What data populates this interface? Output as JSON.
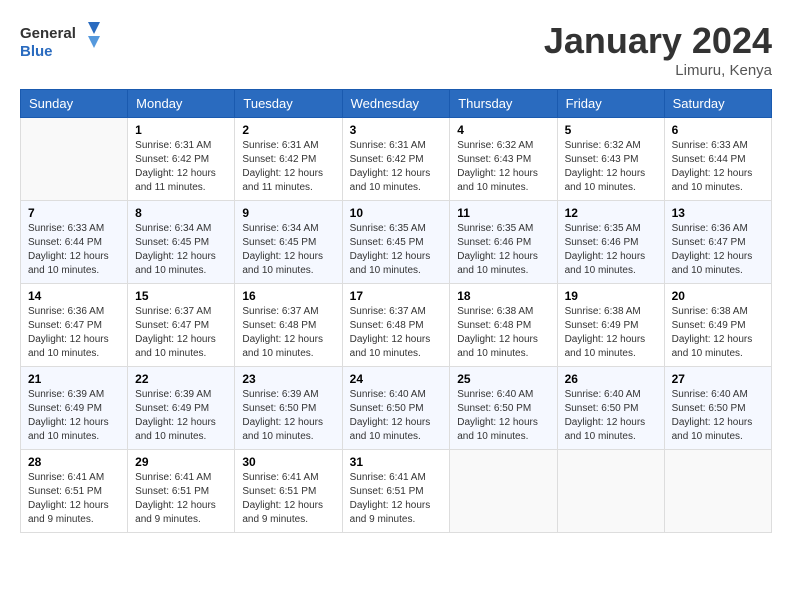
{
  "header": {
    "logo_line1": "General",
    "logo_line2": "Blue",
    "month": "January 2024",
    "location": "Limuru, Kenya"
  },
  "days_of_week": [
    "Sunday",
    "Monday",
    "Tuesday",
    "Wednesday",
    "Thursday",
    "Friday",
    "Saturday"
  ],
  "weeks": [
    [
      {
        "day": "",
        "sunrise": "",
        "sunset": "",
        "daylight": ""
      },
      {
        "day": "1",
        "sunrise": "6:31 AM",
        "sunset": "6:42 PM",
        "daylight": "12 hours and 11 minutes."
      },
      {
        "day": "2",
        "sunrise": "6:31 AM",
        "sunset": "6:42 PM",
        "daylight": "12 hours and 11 minutes."
      },
      {
        "day": "3",
        "sunrise": "6:31 AM",
        "sunset": "6:42 PM",
        "daylight": "12 hours and 10 minutes."
      },
      {
        "day": "4",
        "sunrise": "6:32 AM",
        "sunset": "6:43 PM",
        "daylight": "12 hours and 10 minutes."
      },
      {
        "day": "5",
        "sunrise": "6:32 AM",
        "sunset": "6:43 PM",
        "daylight": "12 hours and 10 minutes."
      },
      {
        "day": "6",
        "sunrise": "6:33 AM",
        "sunset": "6:44 PM",
        "daylight": "12 hours and 10 minutes."
      }
    ],
    [
      {
        "day": "7",
        "sunrise": "6:33 AM",
        "sunset": "6:44 PM",
        "daylight": "12 hours and 10 minutes."
      },
      {
        "day": "8",
        "sunrise": "6:34 AM",
        "sunset": "6:45 PM",
        "daylight": "12 hours and 10 minutes."
      },
      {
        "day": "9",
        "sunrise": "6:34 AM",
        "sunset": "6:45 PM",
        "daylight": "12 hours and 10 minutes."
      },
      {
        "day": "10",
        "sunrise": "6:35 AM",
        "sunset": "6:45 PM",
        "daylight": "12 hours and 10 minutes."
      },
      {
        "day": "11",
        "sunrise": "6:35 AM",
        "sunset": "6:46 PM",
        "daylight": "12 hours and 10 minutes."
      },
      {
        "day": "12",
        "sunrise": "6:35 AM",
        "sunset": "6:46 PM",
        "daylight": "12 hours and 10 minutes."
      },
      {
        "day": "13",
        "sunrise": "6:36 AM",
        "sunset": "6:47 PM",
        "daylight": "12 hours and 10 minutes."
      }
    ],
    [
      {
        "day": "14",
        "sunrise": "6:36 AM",
        "sunset": "6:47 PM",
        "daylight": "12 hours and 10 minutes."
      },
      {
        "day": "15",
        "sunrise": "6:37 AM",
        "sunset": "6:47 PM",
        "daylight": "12 hours and 10 minutes."
      },
      {
        "day": "16",
        "sunrise": "6:37 AM",
        "sunset": "6:48 PM",
        "daylight": "12 hours and 10 minutes."
      },
      {
        "day": "17",
        "sunrise": "6:37 AM",
        "sunset": "6:48 PM",
        "daylight": "12 hours and 10 minutes."
      },
      {
        "day": "18",
        "sunrise": "6:38 AM",
        "sunset": "6:48 PM",
        "daylight": "12 hours and 10 minutes."
      },
      {
        "day": "19",
        "sunrise": "6:38 AM",
        "sunset": "6:49 PM",
        "daylight": "12 hours and 10 minutes."
      },
      {
        "day": "20",
        "sunrise": "6:38 AM",
        "sunset": "6:49 PM",
        "daylight": "12 hours and 10 minutes."
      }
    ],
    [
      {
        "day": "21",
        "sunrise": "6:39 AM",
        "sunset": "6:49 PM",
        "daylight": "12 hours and 10 minutes."
      },
      {
        "day": "22",
        "sunrise": "6:39 AM",
        "sunset": "6:49 PM",
        "daylight": "12 hours and 10 minutes."
      },
      {
        "day": "23",
        "sunrise": "6:39 AM",
        "sunset": "6:50 PM",
        "daylight": "12 hours and 10 minutes."
      },
      {
        "day": "24",
        "sunrise": "6:40 AM",
        "sunset": "6:50 PM",
        "daylight": "12 hours and 10 minutes."
      },
      {
        "day": "25",
        "sunrise": "6:40 AM",
        "sunset": "6:50 PM",
        "daylight": "12 hours and 10 minutes."
      },
      {
        "day": "26",
        "sunrise": "6:40 AM",
        "sunset": "6:50 PM",
        "daylight": "12 hours and 10 minutes."
      },
      {
        "day": "27",
        "sunrise": "6:40 AM",
        "sunset": "6:50 PM",
        "daylight": "12 hours and 10 minutes."
      }
    ],
    [
      {
        "day": "28",
        "sunrise": "6:41 AM",
        "sunset": "6:51 PM",
        "daylight": "12 hours and 9 minutes."
      },
      {
        "day": "29",
        "sunrise": "6:41 AM",
        "sunset": "6:51 PM",
        "daylight": "12 hours and 9 minutes."
      },
      {
        "day": "30",
        "sunrise": "6:41 AM",
        "sunset": "6:51 PM",
        "daylight": "12 hours and 9 minutes."
      },
      {
        "day": "31",
        "sunrise": "6:41 AM",
        "sunset": "6:51 PM",
        "daylight": "12 hours and 9 minutes."
      },
      {
        "day": "",
        "sunrise": "",
        "sunset": "",
        "daylight": ""
      },
      {
        "day": "",
        "sunrise": "",
        "sunset": "",
        "daylight": ""
      },
      {
        "day": "",
        "sunrise": "",
        "sunset": "",
        "daylight": ""
      }
    ]
  ],
  "labels": {
    "sunrise_prefix": "Sunrise: ",
    "sunset_prefix": "Sunset: ",
    "daylight_prefix": "Daylight: "
  }
}
